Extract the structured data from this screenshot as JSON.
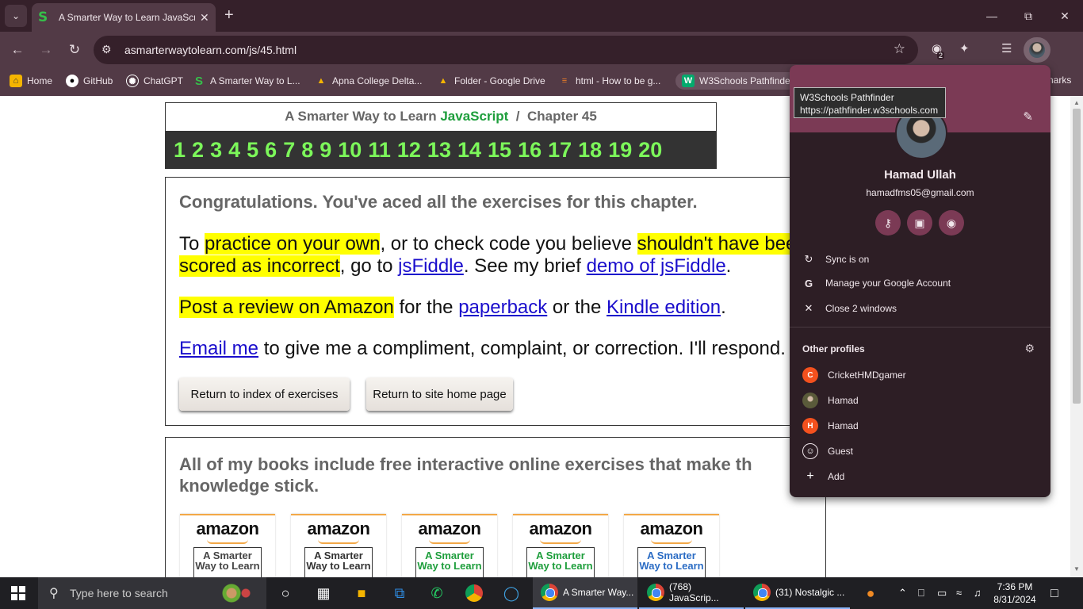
{
  "browser": {
    "tab": {
      "title": "A Smarter Way to Learn JavaScript"
    },
    "url": "asmarterwaytolearn.com/js/45.html",
    "extension_badge": "2",
    "bookmarks": [
      {
        "label": "Home",
        "icon": "home-icon"
      },
      {
        "label": "GitHub",
        "icon": "github-icon"
      },
      {
        "label": "ChatGPT",
        "icon": "chatgpt-icon"
      },
      {
        "label": "A Smarter Way to L...",
        "icon": "smarterway-icon"
      },
      {
        "label": "Apna College Delta...",
        "icon": "drive-icon"
      },
      {
        "label": "Folder - Google Drive",
        "icon": "drive-icon"
      },
      {
        "label": "html - How to be g...",
        "icon": "stackoverflow-icon"
      },
      {
        "label": "W3Schools Pathfinder",
        "icon": "w3schools-icon"
      },
      {
        "label": "narks",
        "icon": ""
      }
    ]
  },
  "page": {
    "chapter": {
      "prefix": "A Smarter Way to Learn ",
      "js": "JavaScript",
      "suffix": "  /  Chapter 45"
    },
    "numbers": [
      "1",
      "2",
      "3",
      "4",
      "5",
      "6",
      "7",
      "8",
      "9",
      "10",
      "11",
      "12",
      "13",
      "14",
      "15",
      "16",
      "17",
      "18",
      "19",
      "20"
    ],
    "congrats": "Congratulations. You've aced all the exercises for this chapter.",
    "p1": {
      "t1": "To ",
      "h1": "practice on your own",
      "t2": ", or to check code you believe ",
      "h2": "shouldn't have bee",
      "h3": "scored as incorrect",
      "t3": ", go to ",
      "l1": "jsFiddle",
      "t4": ". See my brief ",
      "l2": "demo of jsFiddle",
      "t5": "."
    },
    "p2": {
      "h1": "Post a review on Amazon",
      "t1": " for the ",
      "l1": "paperback",
      "t2": " or the ",
      "l2": "Kindle edition",
      "t3": "."
    },
    "p3": {
      "l1": "Email me",
      "t1": " to give me a compliment, complaint, or correction. I'll respond."
    },
    "buttons": {
      "index": "Return to index of exercises",
      "home": "Return to site home page"
    },
    "books_title": " All of my books include free interactive online exercises that make th knowledge stick.",
    "books": [
      {
        "logo": "amazon",
        "cover": "A Smarter Way to Learn",
        "color": "#444"
      },
      {
        "logo": "amazon",
        "cover": "A Smarter Way to Learn",
        "color": "#333"
      },
      {
        "logo": "amazon",
        "cover": "A Smarter Way to Learn",
        "color": "#1e9e3c"
      },
      {
        "logo": "amazon",
        "cover": "A Smarter Way to Learn",
        "color": "#1e9e3c"
      },
      {
        "logo": "amazon",
        "cover": "A Smarter Way to Learn",
        "color": "#2b6cc4"
      }
    ]
  },
  "profile_menu": {
    "tooltip_title": "W3Schools Pathfinder",
    "tooltip_url": "https://pathfinder.w3schools.com",
    "name": "Hamad Ullah",
    "email": "hamadfms05@gmail.com",
    "sync": "Sync is on",
    "manage": "Manage your Google Account",
    "close": "Close 2 windows",
    "other_profiles": "Other profiles",
    "profiles": [
      {
        "name": "CricketHMDgamer",
        "initial": "C",
        "color": "#f4511e"
      },
      {
        "name": "Hamad",
        "initial": "",
        "color": "#8a8a6a"
      },
      {
        "name": "Hamad",
        "initial": "H",
        "color": "#f4511e"
      },
      {
        "name": "Guest",
        "initial": "",
        "color": "transparent"
      }
    ],
    "add": "Add"
  },
  "taskbar": {
    "search_placeholder": "Type here to search",
    "windows": [
      {
        "title": "A Smarter Way..."
      },
      {
        "title": "(768) JavaScrip..."
      },
      {
        "title": "(31) Nostalgic ..."
      }
    ],
    "time": "7:36 PM",
    "date": "8/31/2024"
  }
}
